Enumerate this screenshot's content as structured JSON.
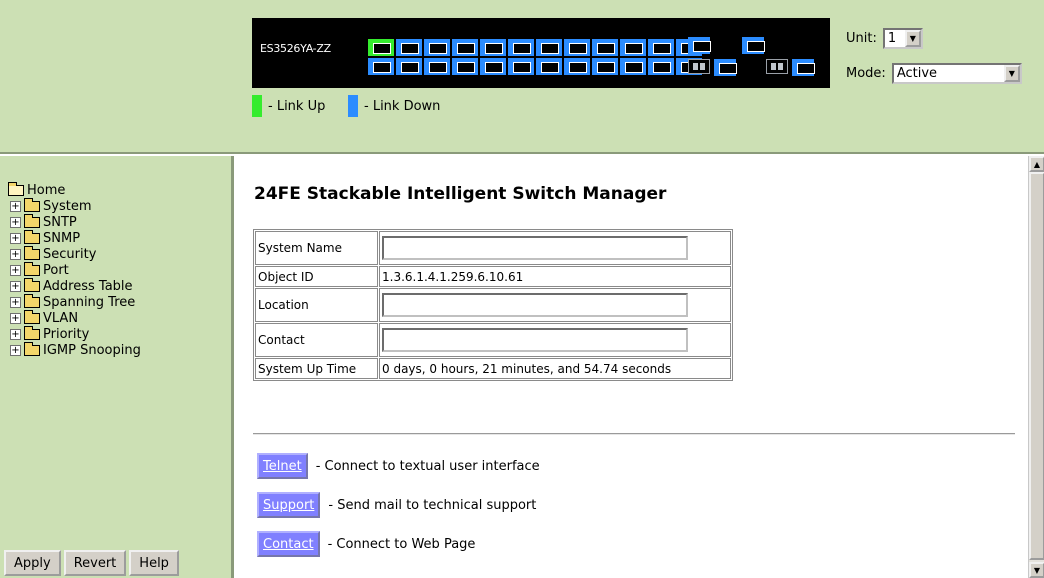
{
  "device": {
    "model": "ES3526YA-ZZ",
    "colors": {
      "link_up": "#35ec2e",
      "link_down": "#2b8cff"
    },
    "ports_top": [
      "up",
      "down",
      "down",
      "down",
      "down",
      "down",
      "down",
      "down",
      "down",
      "down",
      "down",
      "down"
    ],
    "ports_bottom": [
      "down",
      "down",
      "down",
      "down",
      "down",
      "down",
      "down",
      "down",
      "down",
      "down",
      "down",
      "down"
    ]
  },
  "legend": {
    "link_up": "- Link Up",
    "link_down": "- Link Down"
  },
  "unit": {
    "label": "Unit:",
    "value": "1"
  },
  "mode": {
    "label": "Mode:",
    "value": "Active"
  },
  "tree": {
    "root": "Home",
    "items": [
      "System",
      "SNTP",
      "SNMP",
      "Security",
      "Port",
      "Address Table",
      "Spanning Tree",
      "VLAN",
      "Priority",
      "IGMP Snooping"
    ]
  },
  "buttons": {
    "apply": "Apply",
    "revert": "Revert",
    "help": "Help"
  },
  "main": {
    "title": "24FE Stackable Intelligent Switch Manager",
    "rows": {
      "system_name": {
        "label": "System Name",
        "value": ""
      },
      "object_id": {
        "label": "Object ID",
        "value": "1.3.6.1.4.1.259.6.10.61"
      },
      "location": {
        "label": "Location",
        "value": ""
      },
      "contact": {
        "label": "Contact",
        "value": ""
      },
      "uptime": {
        "label": "System Up Time",
        "value": "0 days, 0 hours, 21 minutes, and 54.74 seconds"
      }
    },
    "links": {
      "telnet": {
        "label": "Telnet",
        "desc": "- Connect to textual user interface"
      },
      "support": {
        "label": "Support",
        "desc": "- Send mail to technical support"
      },
      "contact": {
        "label": "Contact",
        "desc": "- Connect to Web Page"
      }
    }
  }
}
